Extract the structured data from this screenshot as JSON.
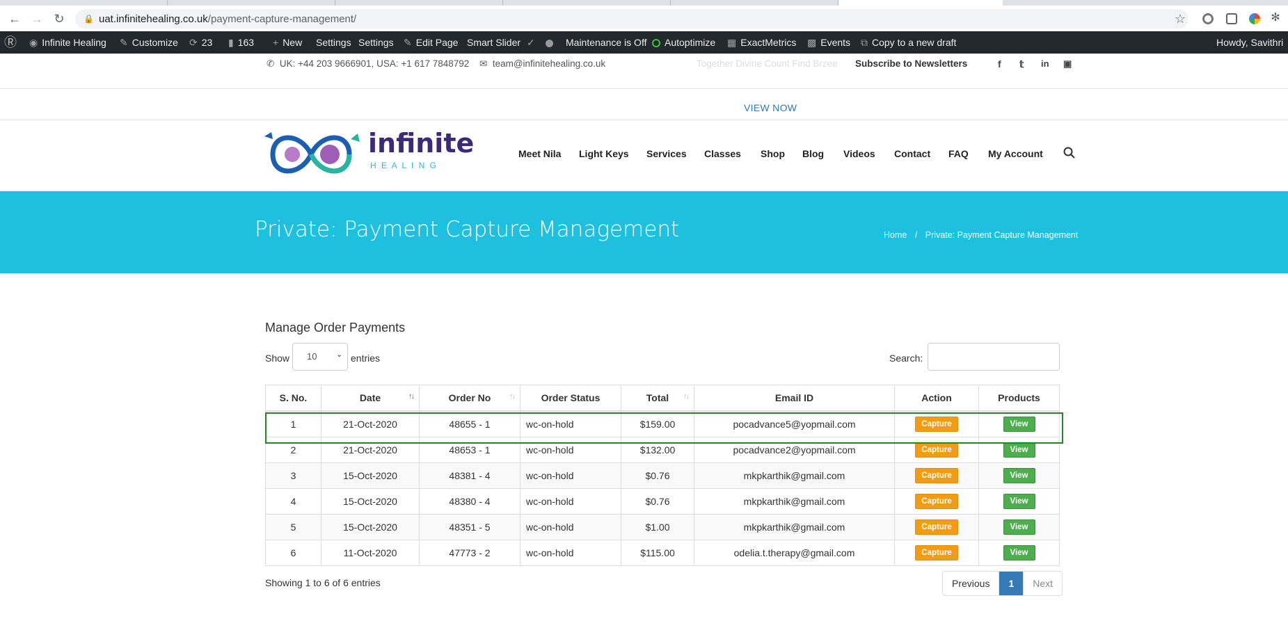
{
  "browser": {
    "url_host": "uat.infinitehealing.co.uk",
    "url_path": "/payment-capture-management/"
  },
  "adminbar": {
    "site": "Infinite Healing",
    "customize": "Customize",
    "updates": "23",
    "comments": "163",
    "new": "New",
    "settings1": "Settings",
    "settings2": "Settings",
    "edit_page": "Edit Page",
    "smart_slider": "Smart Slider",
    "maintenance": "Maintenance is Off",
    "autoptimize": "Autoptimize",
    "exactmetrics": "ExactMetrics",
    "events": "Events",
    "copy_draft": "Copy to a new draft",
    "howdy": "Howdy, Savithri"
  },
  "topbar": {
    "phone": "UK: +44 203 9666901, USA: +1 617 7848792",
    "email": "team@infinitehealing.co.uk",
    "ticker": "Together Divine Count Find Brzee",
    "subscribe": "Subscribe to Newsletters",
    "social_icons": [
      "facebook-icon",
      "twitter-icon",
      "linkedin-icon",
      "instagram-icon"
    ]
  },
  "announcement": {
    "view_now": "VIEW NOW"
  },
  "logo": {
    "word1": "infinite",
    "word2": "H E A L I N G"
  },
  "nav": [
    "Meet Nila",
    "Light Keys",
    "Services",
    "Classes",
    "Shop",
    "Blog",
    "Videos",
    "Contact",
    "FAQ",
    "My Account"
  ],
  "banner": {
    "title": "Private: Payment Capture Management",
    "crumb_home": "Home",
    "crumb_sep": "/",
    "crumb_current": "Private: Payment Capture Management",
    "bg_color": "#1ebfdf"
  },
  "content": {
    "heading": "Manage Order Payments",
    "show_label": "Show",
    "entries_value": "10",
    "entries_label": "entries",
    "search_label": "Search:",
    "search_value": ""
  },
  "table": {
    "columns": [
      "S. No.",
      "Date",
      "Order No",
      "Order Status",
      "Total",
      "Email ID",
      "Action",
      "Products"
    ],
    "rows": [
      {
        "sno": "1",
        "date": "21-Oct-2020",
        "order": "48655 - 1",
        "status": "wc-on-hold",
        "total": "$159.00",
        "email": "pocadvance5@yopmail.com",
        "action": "Capture",
        "products": "View"
      },
      {
        "sno": "2",
        "date": "21-Oct-2020",
        "order": "48653 - 1",
        "status": "wc-on-hold",
        "total": "$132.00",
        "email": "pocadvance2@yopmail.com",
        "action": "Capture",
        "products": "View"
      },
      {
        "sno": "3",
        "date": "15-Oct-2020",
        "order": "48381 - 4",
        "status": "wc-on-hold",
        "total": "$0.76",
        "email": "mkpkarthik@gmail.com",
        "action": "Capture",
        "products": "View"
      },
      {
        "sno": "4",
        "date": "15-Oct-2020",
        "order": "48380 - 4",
        "status": "wc-on-hold",
        "total": "$0.76",
        "email": "mkpkarthik@gmail.com",
        "action": "Capture",
        "products": "View"
      },
      {
        "sno": "5",
        "date": "15-Oct-2020",
        "order": "48351 - 5",
        "status": "wc-on-hold",
        "total": "$1.00",
        "email": "mkpkarthik@gmail.com",
        "action": "Capture",
        "products": "View"
      },
      {
        "sno": "6",
        "date": "11-Oct-2020",
        "order": "47773 - 2",
        "status": "wc-on-hold",
        "total": "$115.00",
        "email": "odelia.t.therapy@gmail.com",
        "action": "Capture",
        "products": "View"
      }
    ]
  },
  "footer": {
    "info": "Showing 1 to 6 of 6 entries",
    "previous": "Previous",
    "page": "1",
    "next": "Next"
  },
  "colors": {
    "capture": "#f39c12",
    "view": "#4cae4c",
    "pager_active": "#337ab7",
    "highlight": "#1e8a1e"
  }
}
